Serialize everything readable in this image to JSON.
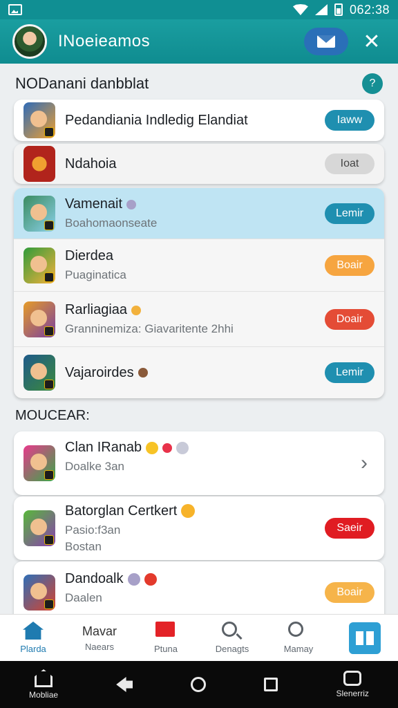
{
  "status_bar": {
    "time": "062:38"
  },
  "app_bar": {
    "title": "INoeieamos"
  },
  "section1": {
    "title": "NODanani danbblat",
    "help_glyph": "?"
  },
  "cards_top": [
    {
      "name": "Pedandiania Indledig Elandiat",
      "button": "Iaww"
    },
    {
      "name": "Ndahoia",
      "button": "Ioat"
    }
  ],
  "group_list": [
    {
      "name": "Vamenait",
      "sub": "Boahomaonseate",
      "button": "Lemir",
      "highlighted": true
    },
    {
      "name": "Dierdea",
      "sub": "Puaginatica",
      "button": "Boair"
    },
    {
      "name": "Rarliagiaa",
      "sub": "Granninemiza: Giavaritente 2hhi",
      "button": "Doair"
    },
    {
      "name": "Vajaroirdes",
      "sub": "",
      "button": "Lemir"
    }
  ],
  "section2": {
    "title": "MOUCEAR:"
  },
  "bottom_cards": [
    {
      "name": "Clan IRanab",
      "sub": "Doalke 3an",
      "sub2": "",
      "action": "chevron"
    },
    {
      "name": "Batorglan Certkert",
      "sub": "Pasio:f3an",
      "sub2": "Bostan",
      "button": "Saeir"
    },
    {
      "name": "Dandoalk",
      "sub": "Daalen",
      "button": "Boair"
    }
  ],
  "bottom_nav": [
    {
      "label": "Plarda",
      "icon": "home-icon",
      "active": true
    },
    {
      "label": "Mavar",
      "sub": "Naears",
      "icon": "text-tab"
    },
    {
      "label": "Ptuna",
      "icon": "flag-icon"
    },
    {
      "label": "Denagts",
      "icon": "search-icon"
    },
    {
      "label": "Mamay",
      "icon": "user-icon"
    },
    {
      "label": "",
      "icon": "grid-icon"
    }
  ],
  "system_nav": [
    {
      "label": "Mobliae",
      "icon": "home-icon"
    },
    {
      "label": "",
      "icon": "back-icon"
    },
    {
      "label": "",
      "icon": "search-icon"
    },
    {
      "label": "",
      "icon": "square-icon"
    },
    {
      "label": "Slenerriz",
      "icon": "menu-icon"
    }
  ],
  "colors": {
    "primary": "#108f93",
    "mail_button": "#2a6fb8",
    "highlight_row": "#bfe4f3",
    "pill_teal": "#1f8fb0",
    "pill_orange": "#f6a540",
    "pill_red": "#e44c36"
  }
}
